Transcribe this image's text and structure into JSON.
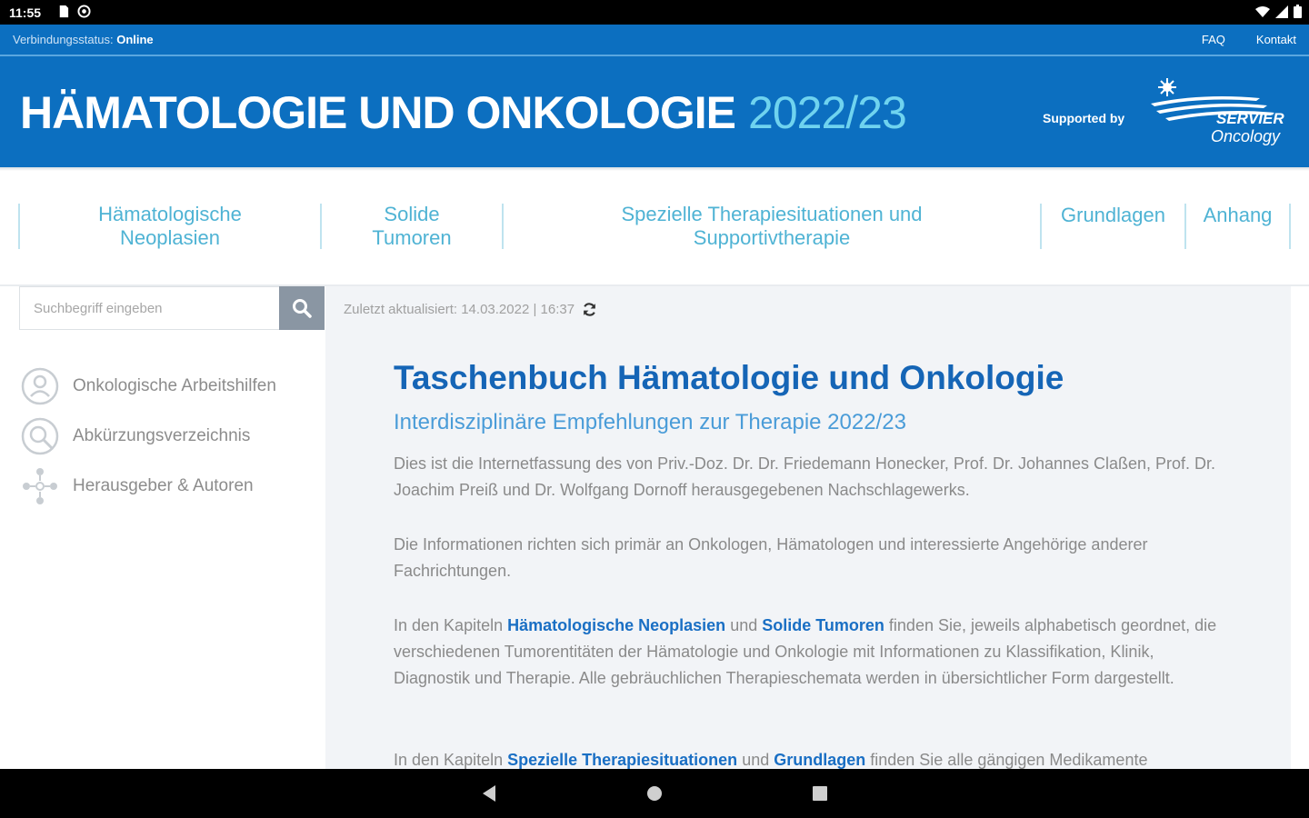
{
  "status_bar": {
    "time": "11:55"
  },
  "connection": {
    "label": "Verbindungsstatus:",
    "status": "Online",
    "links": [
      "FAQ",
      "Kontakt"
    ]
  },
  "header": {
    "title": "HÄMATOLOGIE UND ONKOLOGIE",
    "year": "2022/23",
    "supported_by": "Supported by",
    "logo_text_1": "SERVIER",
    "logo_text_2": "Oncology"
  },
  "nav": {
    "items": [
      {
        "line1": "Hämatologische",
        "line2": "Neoplasien"
      },
      {
        "line1": "Solide",
        "line2": "Tumoren"
      },
      {
        "line1": "Spezielle Therapiesituationen und",
        "line2": "Supportivtherapie"
      },
      {
        "line1": "Grundlagen",
        "line2": ""
      },
      {
        "line1": "Anhang",
        "line2": ""
      }
    ]
  },
  "sidebar": {
    "search_placeholder": "Suchbegriff eingeben",
    "items": [
      {
        "label": "Onkologische Arbeitshilfen",
        "icon": "person-circle-icon"
      },
      {
        "label": "Abkürzungsverzeichnis",
        "icon": "magnifier-circle-icon"
      },
      {
        "label": "Herausgeber & Autoren",
        "icon": "people-network-icon"
      }
    ]
  },
  "main": {
    "updated": "Zuletzt aktualisiert: 14.03.2022 | 16:37",
    "title": "Taschenbuch Hämatologie und Onkologie",
    "subtitle": "Interdisziplinäre Empfehlungen zur Therapie 2022/23",
    "p1": "Dies ist die Internetfassung des von Priv.-Doz. Dr. Dr. Friedemann Honecker, Prof. Dr. Johannes Claßen, Prof. Dr. Joachim Preiß und Dr. Wolfgang Dornoff herausgegebenen Nachschlagewerks.",
    "p2": "Die Informationen richten sich primär an Onkologen, Hämatologen und interessierte Angehörige anderer Fachrichtungen.",
    "p3_a": "In den Kapiteln ",
    "p3_link1": "Hämatologische Neoplasien",
    "p3_b": " und ",
    "p3_link2": "Solide Tumoren",
    "p3_c": " finden Sie, jeweils alphabetisch geordnet, die verschiedenen Tumorentitäten der Hämatologie und Onkologie mit Informationen zu Klassifikation, Klinik, Diagnostik und Therapie. Alle gebräuchlichen Therapieschemata werden in übersichtlicher Form dargestellt.",
    "p4_a": "In den Kapiteln ",
    "p4_link1": "Spezielle Therapiesituationen",
    "p4_b": " und ",
    "p4_link2": "Grundlagen",
    "p4_c": " finden Sie alle gängigen Medikamente"
  }
}
